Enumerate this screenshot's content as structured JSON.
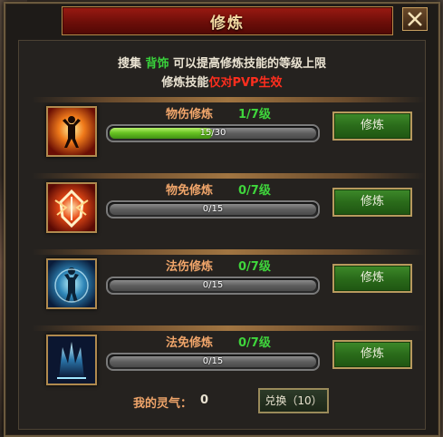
{
  "window": {
    "title": "修炼",
    "close_icon": "close-icon"
  },
  "info": {
    "line1_prefix": "搜集",
    "line1_highlight": "背饰",
    "line1_suffix": "可以提高修炼技能的等级上限",
    "line2_prefix": "修炼技能",
    "line2_highlight": "仅对PVP生效"
  },
  "skills": [
    {
      "icon": "physical-attack-icon",
      "name": "物伤修炼",
      "level": "1/7级",
      "progress_text": "15/30",
      "progress_fraction": 0.5,
      "button": "修炼"
    },
    {
      "icon": "physical-defense-icon",
      "name": "物免修炼",
      "level": "0/7级",
      "progress_text": "0/15",
      "progress_fraction": 0.0,
      "button": "修炼"
    },
    {
      "icon": "magic-attack-icon",
      "name": "法伤修炼",
      "level": "0/7级",
      "progress_text": "0/15",
      "progress_fraction": 0.0,
      "button": "修炼"
    },
    {
      "icon": "magic-defense-icon",
      "name": "法免修炼",
      "level": "0/7级",
      "progress_text": "0/15",
      "progress_fraction": 0.0,
      "button": "修炼"
    }
  ],
  "aura": {
    "label": "我的灵气：",
    "value": "0"
  },
  "exchange_button": "兑换（10）",
  "colors": {
    "accent_green": "#39d23c",
    "warning_red": "#ff2e1e",
    "title_red": "#9b1a12",
    "label_orange": "#f0a56a"
  }
}
